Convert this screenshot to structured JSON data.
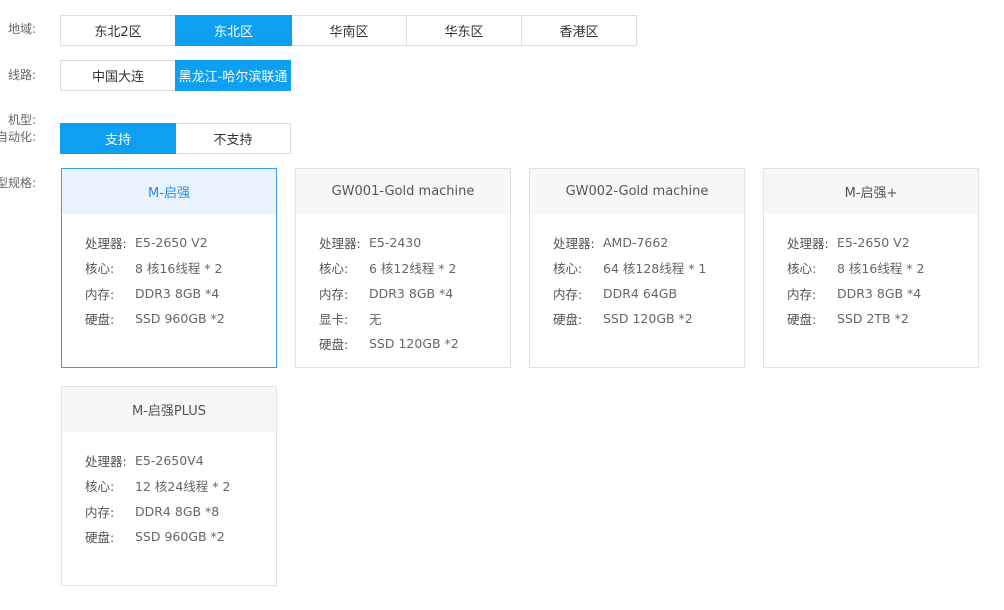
{
  "labels": {
    "region": "地域:",
    "line": "线路:",
    "machine": "机型:",
    "automation": "自动化:",
    "spec": "型规格:"
  },
  "regions": [
    "东北2区",
    "东北区",
    "华南区",
    "华东区",
    "香港区"
  ],
  "region_active": "东北区",
  "lines": [
    "中国大连",
    "黑龙江-哈尔滨联通"
  ],
  "line_active": "黑龙江-哈尔滨联通",
  "automation": {
    "support": "支持",
    "unsupported": "不支持",
    "active": "支持"
  },
  "cards": [
    {
      "title": "M-启强",
      "selected": true,
      "specs": [
        {
          "k": "处理器:",
          "v": "E5-2650 V2"
        },
        {
          "k": "核心:",
          "v": "8 核16线程 * 2"
        },
        {
          "k": "内存:",
          "v": "DDR3 8GB *4"
        },
        {
          "k": "硬盘:",
          "v": "SSD 960GB *2"
        }
      ]
    },
    {
      "title": "GW001-Gold machine",
      "selected": false,
      "specs": [
        {
          "k": "处理器:",
          "v": "E5-2430"
        },
        {
          "k": "核心:",
          "v": "6 核12线程 * 2"
        },
        {
          "k": "内存:",
          "v": "DDR3 8GB *4"
        },
        {
          "k": "显卡:",
          "v": "无"
        },
        {
          "k": "硬盘:",
          "v": "SSD 120GB *2"
        }
      ]
    },
    {
      "title": "GW002-Gold machine",
      "selected": false,
      "specs": [
        {
          "k": "处理器:",
          "v": "AMD-7662"
        },
        {
          "k": "核心:",
          "v": "64 核128线程 * 1"
        },
        {
          "k": "内存:",
          "v": "DDR4 64GB"
        },
        {
          "k": "硬盘:",
          "v": "SSD 120GB *2"
        }
      ]
    },
    {
      "title": "M-启强+",
      "selected": false,
      "specs": [
        {
          "k": "处理器:",
          "v": "E5-2650 V2"
        },
        {
          "k": "核心:",
          "v": "8 核16线程 * 2"
        },
        {
          "k": "内存:",
          "v": "DDR3 8GB *4"
        },
        {
          "k": "硬盘:",
          "v": "SSD 2TB *2"
        }
      ]
    },
    {
      "title": "M-启强PLUS",
      "selected": false,
      "specs": [
        {
          "k": "处理器:",
          "v": "E5-2650V4"
        },
        {
          "k": "核心:",
          "v": "12 核24线程 * 2"
        },
        {
          "k": "内存:",
          "v": "DDR4 8GB *8"
        },
        {
          "k": "硬盘:",
          "v": "SSD 960GB *2"
        }
      ]
    }
  ],
  "colors": {
    "accent": "#0ea0f0",
    "selected_border": "#3c9ee9",
    "selected_header": "#e8f3fd"
  }
}
